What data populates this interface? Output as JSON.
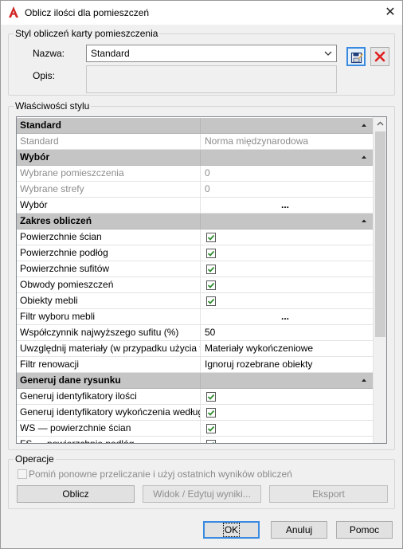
{
  "window": {
    "title": "Oblicz ilości dla pomieszczeń",
    "close_label": "✕"
  },
  "style_group": {
    "label": "Styl obliczeń karty pomieszczenia",
    "name_label": "Nazwa:",
    "name_value": "Standard",
    "desc_label": "Opis:",
    "desc_value": ""
  },
  "props_group": {
    "label": "Właściwości stylu",
    "rows": [
      {
        "type": "category",
        "name": "Standard"
      },
      {
        "type": "readonly",
        "name": "Standard",
        "value": "Norma międzynarodowa"
      },
      {
        "type": "category",
        "name": "Wybór"
      },
      {
        "type": "readonly",
        "name": "Wybrane pomieszczenia",
        "value": "0"
      },
      {
        "type": "readonly",
        "name": "Wybrane strefy",
        "value": "0"
      },
      {
        "type": "ellipsis",
        "name": "Wybór",
        "value": "..."
      },
      {
        "type": "category",
        "name": "Zakres obliczeń"
      },
      {
        "type": "check",
        "name": "Powierzchnie ścian",
        "checked": true
      },
      {
        "type": "check",
        "name": "Powierzchnie podłóg",
        "checked": true
      },
      {
        "type": "check",
        "name": "Powierzchnie sufitów",
        "checked": true
      },
      {
        "type": "check",
        "name": "Obwody pomieszczeń",
        "checked": true
      },
      {
        "type": "check",
        "name": "Obiekty mebli",
        "checked": true
      },
      {
        "type": "ellipsis",
        "name": "Filtr wyboru mebli",
        "value": "..."
      },
      {
        "type": "text",
        "name": "Współczynnik najwyższego sufitu (%)",
        "value": "50"
      },
      {
        "type": "text",
        "name": "Uwzględnij materiały (w przypadku użycia typu",
        "value": "Materiały wykończeniowe"
      },
      {
        "type": "text",
        "name": "Filtr renowacji",
        "value": "Ignoruj rozebrane obiekty"
      },
      {
        "type": "category",
        "name": "Generuj dane rysunku"
      },
      {
        "type": "check",
        "name": "Generuj identyfikatory ilości",
        "checked": true
      },
      {
        "type": "check",
        "name": "Generuj identyfikatory wykończenia według",
        "checked": true
      },
      {
        "type": "check",
        "name": "WS — powierzchnie ścian",
        "checked": true
      },
      {
        "type": "check",
        "name": "FS — powierzchnie podłóg",
        "checked": true
      }
    ]
  },
  "operations": {
    "label": "Operacje",
    "skip_label": "Pomiń ponowne przeliczanie i użyj ostatnich wyników obliczeń",
    "calc_button": "Oblicz",
    "view_edit_button": "Widok / Edytuj wyniki...",
    "export_button": "Eksport"
  },
  "footer": {
    "ok": "OK",
    "cancel": "Anuluj",
    "help": "Pomoc"
  },
  "icons": {
    "app": "autocad-a-icon",
    "save_style": "save-style-icon",
    "delete_style": "delete-x-icon",
    "collapse": "collapse-triangle-icon",
    "check": "checkbox-checked-icon"
  },
  "colors": {
    "accent": "#3a8ae0",
    "check_green": "#2e8b2e",
    "delete_red": "#e02020",
    "category_bg": "#c5c5c5"
  }
}
